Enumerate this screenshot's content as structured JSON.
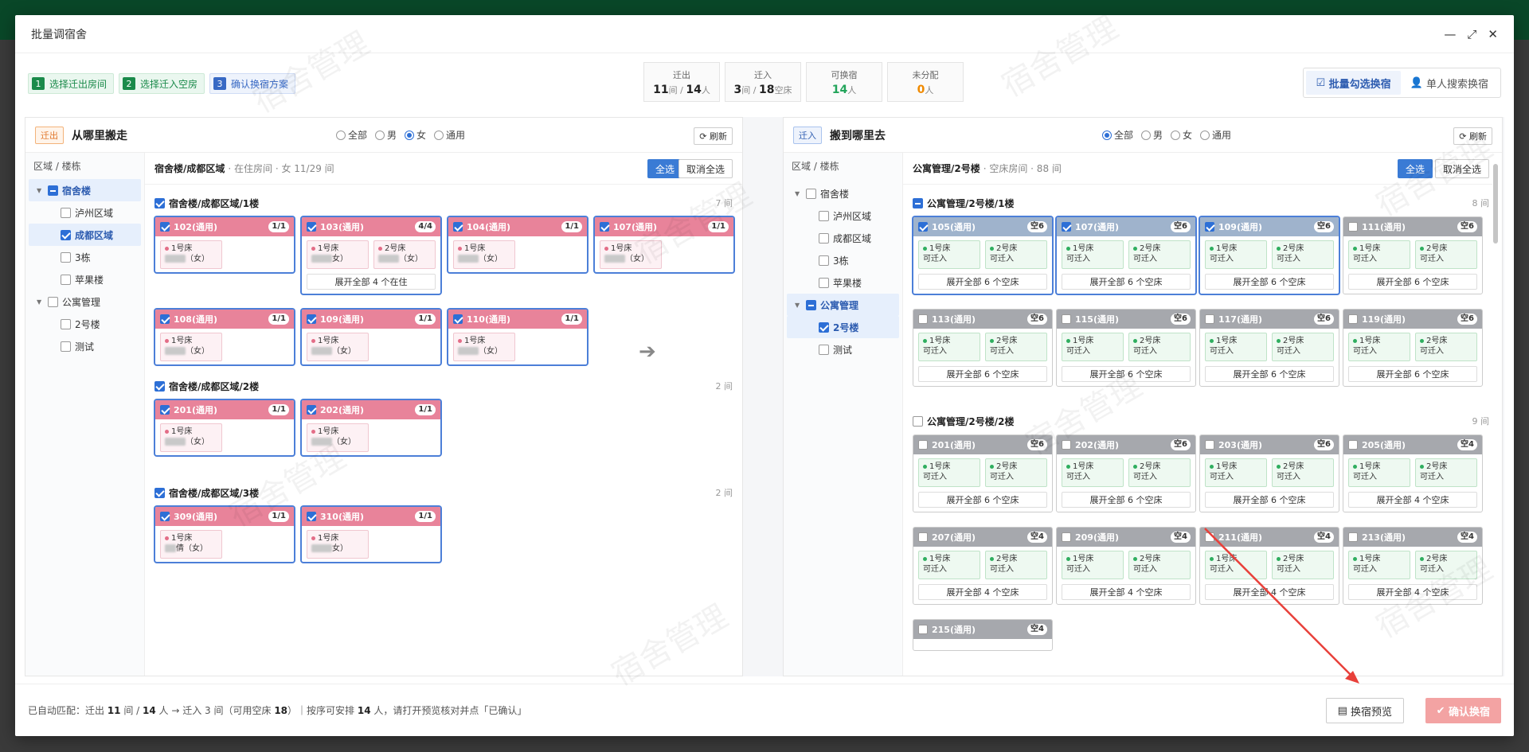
{
  "modal": {
    "title": "批量调宿舍"
  },
  "steps": [
    {
      "num": "1",
      "label": "选择迁出房间"
    },
    {
      "num": "2",
      "label": "选择迁入空房"
    },
    {
      "num": "3",
      "label": "确认换宿方案"
    }
  ],
  "stats": {
    "out": {
      "label": "迁出",
      "rooms": "11",
      "u1": "间 / ",
      "people": "14",
      "u2": "人"
    },
    "in": {
      "label": "迁入",
      "rooms": "3",
      "u1": "间 / ",
      "beds": "18",
      "u2": "空床"
    },
    "swap": {
      "label": "可换宿",
      "val": "14",
      "u": "人"
    },
    "unassigned": {
      "label": "未分配",
      "val": "0",
      "u": "人"
    }
  },
  "modes": {
    "batch": "批量勾选换宿",
    "single": "单人搜索换宿"
  },
  "left": {
    "tag": "迁出",
    "title": "从哪里搬走",
    "radios": [
      "全部",
      "男",
      "女",
      "通用"
    ],
    "refresh": "刷新",
    "tree_title": "区域 / 楼栋",
    "tree": [
      "宿舍楼",
      "泸州区域",
      "成都区域",
      "3栋",
      "苹果楼",
      "公寓管理",
      "2号楼",
      "测试"
    ],
    "crumb": "宿舍楼/成都区域",
    "crumb_sub": "· 在住房间 · 女 11/29 间",
    "select_all": "全选",
    "cancel_all": "取消全选",
    "floors": [
      {
        "title": "宿舍楼/成都区域/1楼",
        "count": "7 间"
      },
      {
        "title": "宿舍楼/成都区域/2楼",
        "count": "2 间"
      },
      {
        "title": "宿舍楼/成都区域/3楼",
        "count": "2 间"
      }
    ],
    "rooms": [
      {
        "name": "102(通用)",
        "badge": "1/1"
      },
      {
        "name": "103(通用)",
        "badge": "4/4"
      },
      {
        "name": "104(通用)",
        "badge": "1/1"
      },
      {
        "name": "107(通用)",
        "badge": "1/1"
      },
      {
        "name": "108(通用)",
        "badge": "1/1"
      },
      {
        "name": "109(通用)",
        "badge": "1/1"
      },
      {
        "name": "110(通用)",
        "badge": "1/1"
      },
      {
        "name": "201(通用)",
        "badge": "1/1"
      },
      {
        "name": "202(通用)",
        "badge": "1/1"
      },
      {
        "name": "309(通用)",
        "badge": "1/1"
      },
      {
        "name": "310(通用)",
        "badge": "1/1"
      }
    ],
    "bed1": "1号床",
    "bed2": "2号床",
    "female": "（女）",
    "female_b": "女）",
    "name_309": "倩（女）",
    "expand_103": "展开全部 4 个在住"
  },
  "right": {
    "tag": "迁入",
    "title": "搬到哪里去",
    "radios": [
      "全部",
      "男",
      "女",
      "通用"
    ],
    "refresh": "刷新",
    "tree_title": "区域 / 楼栋",
    "tree": [
      "宿舍楼",
      "泸州区域",
      "成都区域",
      "3栋",
      "苹果楼",
      "公寓管理",
      "2号楼",
      "测试"
    ],
    "crumb": "公寓管理/2号楼",
    "crumb_sub": "· 空床房间 · 88 间",
    "select_all": "全选",
    "cancel_all": "取消全选",
    "floors": [
      {
        "title": "公寓管理/2号楼/1楼",
        "count": "8 间"
      },
      {
        "title": "公寓管理/2号楼/2楼",
        "count": "9 间"
      }
    ],
    "rooms1": [
      {
        "name": "105(通用)",
        "badge": "空6"
      },
      {
        "name": "107(通用)",
        "badge": "空6"
      },
      {
        "name": "109(通用)",
        "badge": "空6"
      },
      {
        "name": "111(通用)",
        "badge": "空6"
      },
      {
        "name": "113(通用)",
        "badge": "空6"
      },
      {
        "name": "115(通用)",
        "badge": "空6"
      },
      {
        "name": "117(通用)",
        "badge": "空6"
      },
      {
        "name": "119(通用)",
        "badge": "空6"
      }
    ],
    "rooms2": [
      {
        "name": "201(通用)",
        "badge": "空6"
      },
      {
        "name": "202(通用)",
        "badge": "空6"
      },
      {
        "name": "203(通用)",
        "badge": "空6"
      },
      {
        "name": "205(通用)",
        "badge": "空4"
      },
      {
        "name": "207(通用)",
        "badge": "空4"
      },
      {
        "name": "209(通用)",
        "badge": "空4"
      },
      {
        "name": "211(通用)",
        "badge": "空4"
      },
      {
        "name": "213(通用)",
        "badge": "空4"
      },
      {
        "name": "215(通用)",
        "badge": "空4"
      }
    ],
    "bed1": "1号床",
    "bed2": "2号床",
    "avail": "可迁入",
    "expand6": "展开全部 6 个空床",
    "expand4": "展开全部 4 个空床"
  },
  "footer": {
    "p1": "已自动匹配：迁出 ",
    "rooms": "11",
    "p2": " 间 / ",
    "people": "14",
    "p3": " 人 → 迁入 3 间（可用空床 ",
    "beds": "18",
    "p4": "）｜按序可安排 ",
    "arrange": "14",
    "p5": " 人，请打开预览核对并点「已确认」",
    "preview": "换宿预览",
    "confirm": "确认换宿"
  },
  "watermark": "宿舍管理"
}
